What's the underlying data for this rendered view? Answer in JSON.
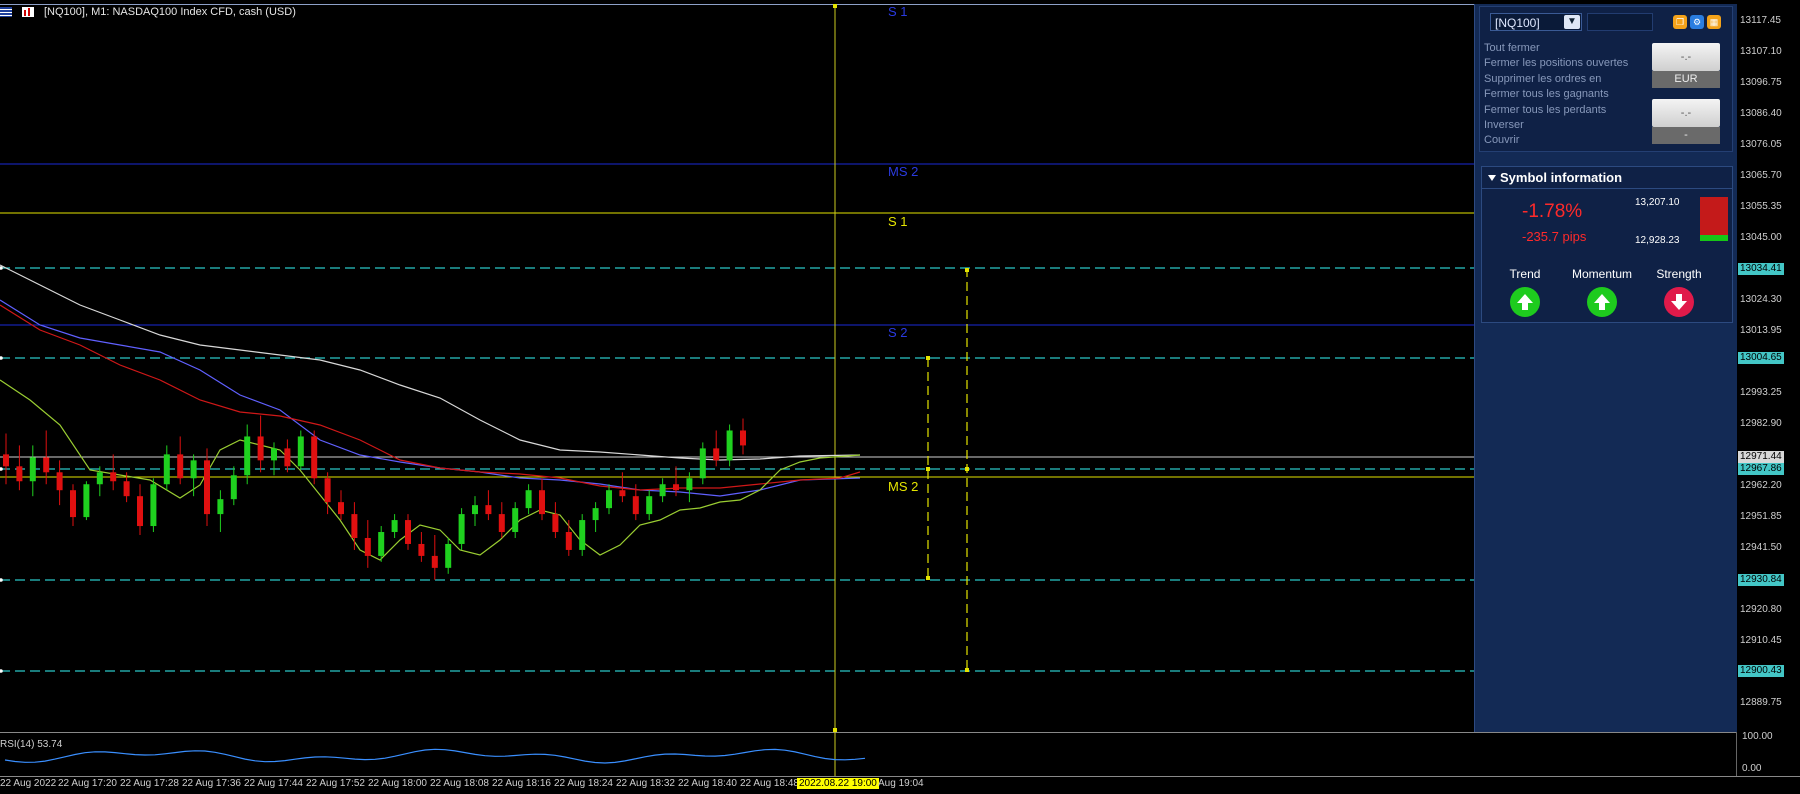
{
  "header": {
    "title": "[NQ100], M1:  NASDAQ100 Index CFD, cash (USD)"
  },
  "levels": {
    "s1_top": "S 1",
    "ms2_top": "MS 2",
    "s1": "S 1",
    "s2": "S 2",
    "ms2_bottom": "MS 2"
  },
  "price_axis": [
    "13117.45",
    "13107.10",
    "13096.75",
    "13086.40",
    "13076.05",
    "13065.70",
    "13055.35",
    "13045.00",
    "13024.30",
    "13013.95",
    "12993.25",
    "12982.90",
    "12962.20",
    "12951.85",
    "12941.50",
    "12920.80",
    "12910.45",
    "12889.75"
  ],
  "price_tags": {
    "cyan1": "13034.41",
    "cyan2": "13004.65",
    "white1": "12971.44",
    "cyan3": "12967.86",
    "cyan4": "12930.84",
    "cyan5": "12900.43"
  },
  "time_axis": [
    "22 Aug 2022",
    "22 Aug 17:20",
    "22 Aug 17:28",
    "22 Aug 17:36",
    "22 Aug 17:44",
    "22 Aug 17:52",
    "22 Aug 18:00",
    "22 Aug 18:08",
    "22 Aug 18:16",
    "22 Aug 18:24",
    "22 Aug 18:32",
    "22 Aug 18:40",
    "22 Aug 18:48"
  ],
  "time_cursor": "2022.08.22 19:00",
  "time_after": "Aug 19:04",
  "rsi": {
    "label": "RSI(14) 53.74",
    "axis_top": "100.00",
    "axis_bottom": "0.00"
  },
  "panel": {
    "symbol": "[NQ100]",
    "menu": [
      "Tout fermer",
      "Fermer les positions ouvertes",
      "Supprimer les ordres en",
      "Fermer tous les gagnants",
      "Fermer tous les perdants",
      "Inverser",
      "Couvrir"
    ],
    "value1": "-.-",
    "currency": "EUR",
    "value2": "-.-",
    "value3": "-",
    "symbol_info": {
      "title": "Symbol information",
      "change_pct": "-1.78%",
      "change_pips": "-235.7 pips",
      "high": "13,207.10",
      "low": "12,928.23",
      "trend_label": "Trend",
      "momentum_label": "Momentum",
      "strength_label": "Strength"
    }
  },
  "colors": {
    "bull": "#1fd11f",
    "bear": "#e01010",
    "cyan_level": "#2ac6c6",
    "yellow_level": "#e4e400",
    "blue_level": "#1a2ad6"
  },
  "chart_data": {
    "type": "candlestick",
    "ohlc": [
      [
        12972,
        12979,
        12962,
        12968
      ],
      [
        12968,
        12975,
        12960,
        12963
      ],
      [
        12963,
        12975,
        12958,
        12971
      ],
      [
        12971,
        12980,
        12962,
        12966
      ],
      [
        12966,
        12970,
        12955,
        12960
      ],
      [
        12960,
        12962,
        12948,
        12951
      ],
      [
        12951,
        12963,
        12950,
        12962
      ],
      [
        12962,
        12968,
        12958,
        12966
      ],
      [
        12966,
        12972,
        12960,
        12963
      ],
      [
        12963,
        12966,
        12956,
        12958
      ],
      [
        12958,
        12962,
        12945,
        12948
      ],
      [
        12948,
        12964,
        12946,
        12962
      ],
      [
        12962,
        12975,
        12960,
        12972
      ],
      [
        12972,
        12978,
        12962,
        12964
      ],
      [
        12964,
        12972,
        12958,
        12970
      ],
      [
        12970,
        12974,
        12948,
        12952
      ],
      [
        12952,
        12960,
        12946,
        12957
      ],
      [
        12957,
        12968,
        12955,
        12965
      ],
      [
        12965,
        12982,
        12962,
        12978
      ],
      [
        12978,
        12985,
        12966,
        12970
      ],
      [
        12970,
        12976,
        12965,
        12974
      ],
      [
        12974,
        12977,
        12966,
        12968
      ],
      [
        12968,
        12980,
        12967,
        12978
      ],
      [
        12978,
        12980,
        12962,
        12964
      ],
      [
        12964,
        12966,
        12952,
        12956
      ],
      [
        12956,
        12960,
        12950,
        12952
      ],
      [
        12952,
        12956,
        12940,
        12944
      ],
      [
        12944,
        12950,
        12934,
        12938
      ],
      [
        12938,
        12948,
        12936,
        12946
      ],
      [
        12946,
        12952,
        12944,
        12950
      ],
      [
        12950,
        12952,
        12940,
        12942
      ],
      [
        12942,
        12946,
        12936,
        12938
      ],
      [
        12938,
        12945,
        12930,
        12934
      ],
      [
        12934,
        12944,
        12932,
        12942
      ],
      [
        12942,
        12954,
        12940,
        12952
      ],
      [
        12952,
        12958,
        12948,
        12955
      ],
      [
        12955,
        12960,
        12950,
        12952
      ],
      [
        12952,
        12956,
        12944,
        12946
      ],
      [
        12946,
        12956,
        12944,
        12954
      ],
      [
        12954,
        12962,
        12952,
        12960
      ],
      [
        12960,
        12964,
        12950,
        12952
      ],
      [
        12952,
        12956,
        12944,
        12946
      ],
      [
        12946,
        12950,
        12938,
        12940
      ],
      [
        12940,
        12952,
        12938,
        12950
      ],
      [
        12950,
        12956,
        12946,
        12954
      ],
      [
        12954,
        12962,
        12952,
        12960
      ],
      [
        12960,
        12966,
        12956,
        12958
      ],
      [
        12958,
        12962,
        12950,
        12952
      ],
      [
        12952,
        12960,
        12950,
        12958
      ],
      [
        12958,
        12964,
        12956,
        12962
      ],
      [
        12962,
        12968,
        12958,
        12960
      ],
      [
        12960,
        12966,
        12956,
        12964
      ],
      [
        12964,
        12976,
        12962,
        12974
      ],
      [
        12974,
        12980,
        12968,
        12970
      ],
      [
        12970,
        12982,
        12968,
        12980
      ],
      [
        12980,
        12984,
        12972,
        12975
      ]
    ]
  }
}
